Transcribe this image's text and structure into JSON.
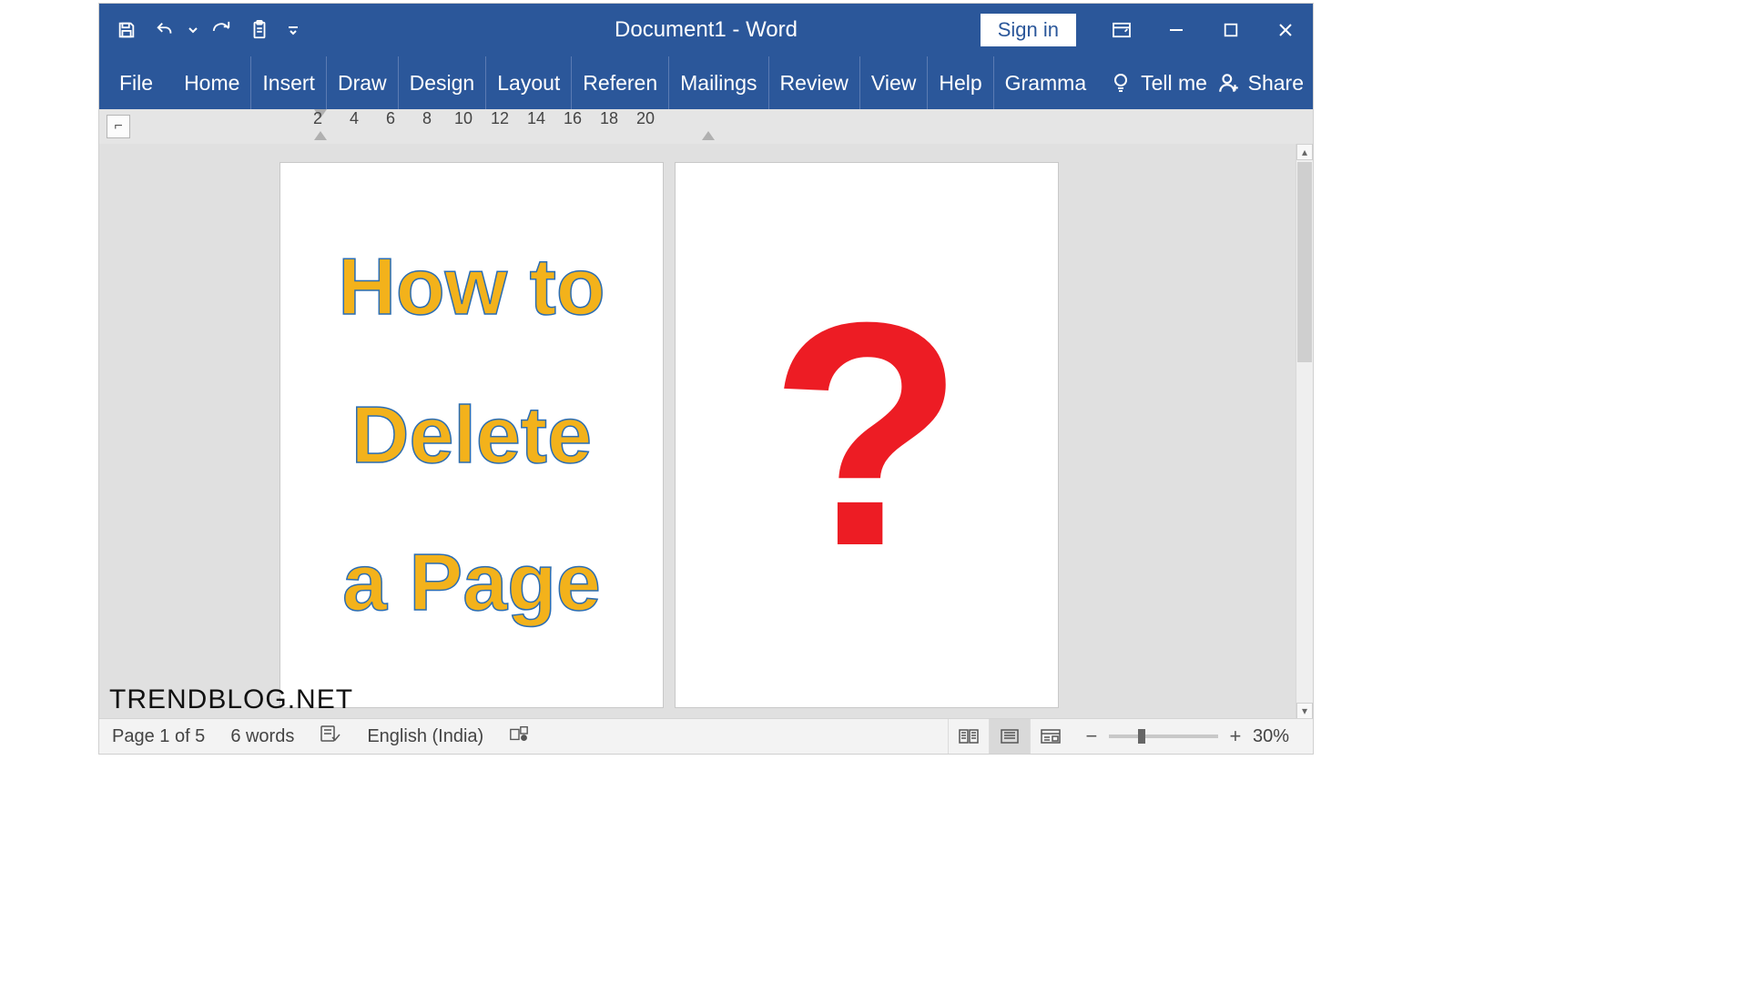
{
  "title": "Document1  -  Word",
  "signin_label": "Sign in",
  "tabs": {
    "file": "File",
    "home": "Home",
    "insert": "Insert",
    "draw": "Draw",
    "design": "Design",
    "layout": "Layout",
    "references": "Referen",
    "mailings": "Mailings",
    "review": "Review",
    "view": "View",
    "help": "Help",
    "grammar": "Gramma"
  },
  "tellme": "Tell me",
  "share": "Share",
  "ruler": {
    "numbers": [
      "2",
      "4",
      "6",
      "8",
      "10",
      "12",
      "14",
      "16",
      "18",
      "20"
    ],
    "corner": "⌐"
  },
  "page1": {
    "line1": "How to",
    "line2": "Delete",
    "line3": "a Page"
  },
  "page2": {
    "symbol": "?"
  },
  "status": {
    "page": "Page 1 of 5",
    "words": "6 words",
    "language": "English (India)",
    "zoom": "30%"
  },
  "watermark": "TRENDBLOG.NET",
  "icons": {
    "save": "save-icon",
    "undo": "undo-icon",
    "redo": "redo-icon",
    "clipboard": "clipboard-icon",
    "customize": "customize-qat-icon",
    "ribbon_opts": "ribbon-display-icon",
    "minimize": "minimize-icon",
    "maximize": "maximize-icon",
    "close": "close-icon",
    "bulb": "lightbulb-icon",
    "person": "person-plus-icon",
    "spell": "spellcheck-icon",
    "macro": "macro-record-icon",
    "read": "read-mode-icon",
    "print": "print-layout-icon",
    "web": "web-layout-icon",
    "minus": "−",
    "plus": "+"
  }
}
